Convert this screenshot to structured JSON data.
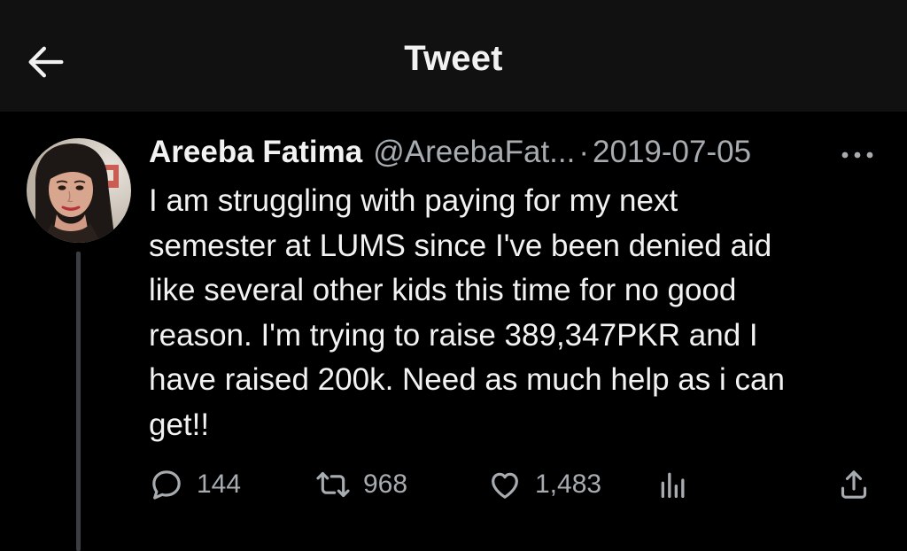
{
  "header": {
    "title": "Tweet",
    "back_icon": "arrow-left-icon"
  },
  "tweet": {
    "author": {
      "display_name": "Areeba Fatima",
      "handle": "@AreebaFat...",
      "avatar_icon": "profile-photo"
    },
    "separator": "·",
    "date": "2019-07-05",
    "more_icon": "more-horizontal-icon",
    "text": "I am struggling with paying for my next\nsemester at LUMS since I've been denied aid\nlike several other kids this time for no good\nreason. I'm trying to raise 389,347PKR and I\nhave raised 200k. Need as much help as i can\nget!!",
    "actions": {
      "reply": {
        "icon": "reply-icon",
        "count": "144"
      },
      "retweet": {
        "icon": "retweet-icon",
        "count": "968"
      },
      "like": {
        "icon": "heart-icon",
        "count": "1,483"
      },
      "views": {
        "icon": "analytics-icon"
      },
      "share": {
        "icon": "share-icon"
      }
    }
  },
  "colors": {
    "background": "#000000",
    "header_background": "#111111",
    "primary_text": "#f2f2f2",
    "secondary_text": "#a7acb1",
    "thread_line": "#3a3d41"
  }
}
